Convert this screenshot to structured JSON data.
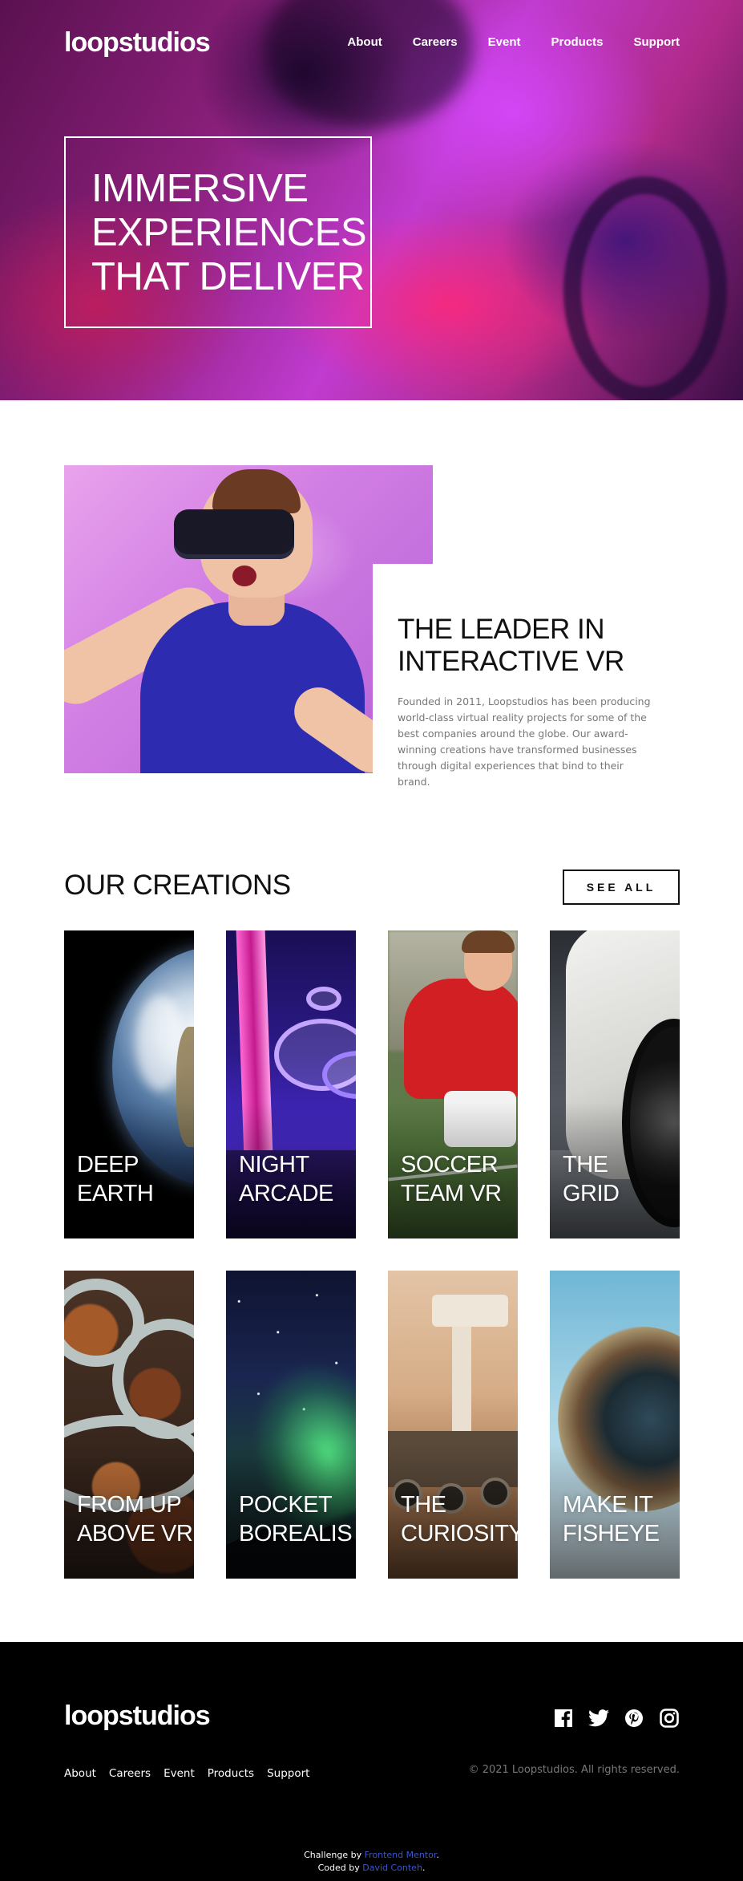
{
  "brand": {
    "logo_text": "loopstudios"
  },
  "nav": {
    "items": [
      "About",
      "Careers",
      "Event",
      "Products",
      "Support"
    ]
  },
  "hero": {
    "headline_lines": [
      "IMMERSIVE",
      "EXPERIENCES",
      "THAT DELIVER"
    ]
  },
  "about": {
    "title_lines": [
      "THE LEADER IN",
      "INTERACTIVE VR"
    ],
    "body": "Founded in 2011, Loopstudios has been producing world-class virtual reality projects for some of the best companies around the globe. Our award-winning creations have transformed businesses through digital experiences that bind to their brand."
  },
  "creations": {
    "title": "OUR CREATIONS",
    "see_all_label": "SEE ALL",
    "cards": [
      {
        "lines": [
          "DEEP",
          "EARTH"
        ],
        "image": "earth"
      },
      {
        "lines": [
          "NIGHT",
          "ARCADE"
        ],
        "image": "arcade"
      },
      {
        "lines": [
          "SOCCER",
          "TEAM VR"
        ],
        "image": "soccer"
      },
      {
        "lines": [
          "THE",
          "GRID"
        ],
        "image": "grid"
      },
      {
        "lines": [
          "FROM UP",
          "ABOVE VR"
        ],
        "image": "fromup"
      },
      {
        "lines": [
          "POCKET",
          "BOREALIS"
        ],
        "image": "borealis"
      },
      {
        "lines": [
          "THE",
          "CURIOSITY"
        ],
        "image": "curiosity"
      },
      {
        "lines": [
          "MAKE IT",
          "FISHEYE"
        ],
        "image": "fisheye"
      }
    ]
  },
  "footer": {
    "logo_text": "loopstudios",
    "nav": [
      "About",
      "Careers",
      "Event",
      "Products",
      "Support"
    ],
    "social_icons": [
      "facebook-icon",
      "twitter-icon",
      "pinterest-icon",
      "instagram-icon"
    ],
    "copyright": "© 2021 Loopstudios. All rights reserved.",
    "attribution": {
      "challenge_prefix": "Challenge by ",
      "challenge_link": "Frontend Mentor",
      "coded_prefix": "Coded by ",
      "coded_link": "David Conteh",
      "suffix": "."
    }
  },
  "colors": {
    "footer_bg": "#000000",
    "attribution_link": "#3b56c9"
  }
}
